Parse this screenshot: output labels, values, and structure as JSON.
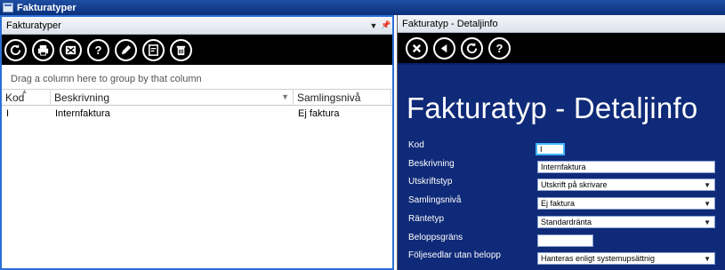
{
  "window": {
    "title": "Fakturatyper"
  },
  "left_pane": {
    "title": "Fakturatyper",
    "group_hint": "Drag a column here to group by that column",
    "columns": [
      "Kod",
      "Beskrivning",
      "Samlingsnivå"
    ],
    "rows": [
      {
        "kod": "I",
        "beskrivning": "Internfaktura",
        "samlingsniva": "Ej faktura"
      }
    ],
    "toolbar": [
      "refresh-icon",
      "print-icon",
      "export-icon",
      "help-icon",
      "edit-icon",
      "new-icon",
      "delete-icon"
    ]
  },
  "right_pane": {
    "title": "Fakturatyp - Detaljinfo",
    "heading": "Fakturatyp - Detaljinfo",
    "toolbar": [
      "close-icon",
      "back-icon",
      "refresh-icon",
      "help-icon"
    ],
    "fields": {
      "kod": {
        "label": "Kod",
        "value": "I"
      },
      "beskrivning": {
        "label": "Beskrivning",
        "value": "Internfaktura"
      },
      "utskriftstyp": {
        "label": "Utskriftstyp",
        "value": "Utskrift på skrivare"
      },
      "samlingsniva": {
        "label": "Samlingsnivå",
        "value": "Ej faktura"
      },
      "rantetyp": {
        "label": "Räntetyp",
        "value": "Standardränta"
      },
      "beloppsgrans": {
        "label": "Beloppsgräns",
        "value": ""
      },
      "foljesedlar": {
        "label": "Följesedlar utan belopp",
        "value": "Hanteras enligt systemupsättnig"
      }
    }
  }
}
